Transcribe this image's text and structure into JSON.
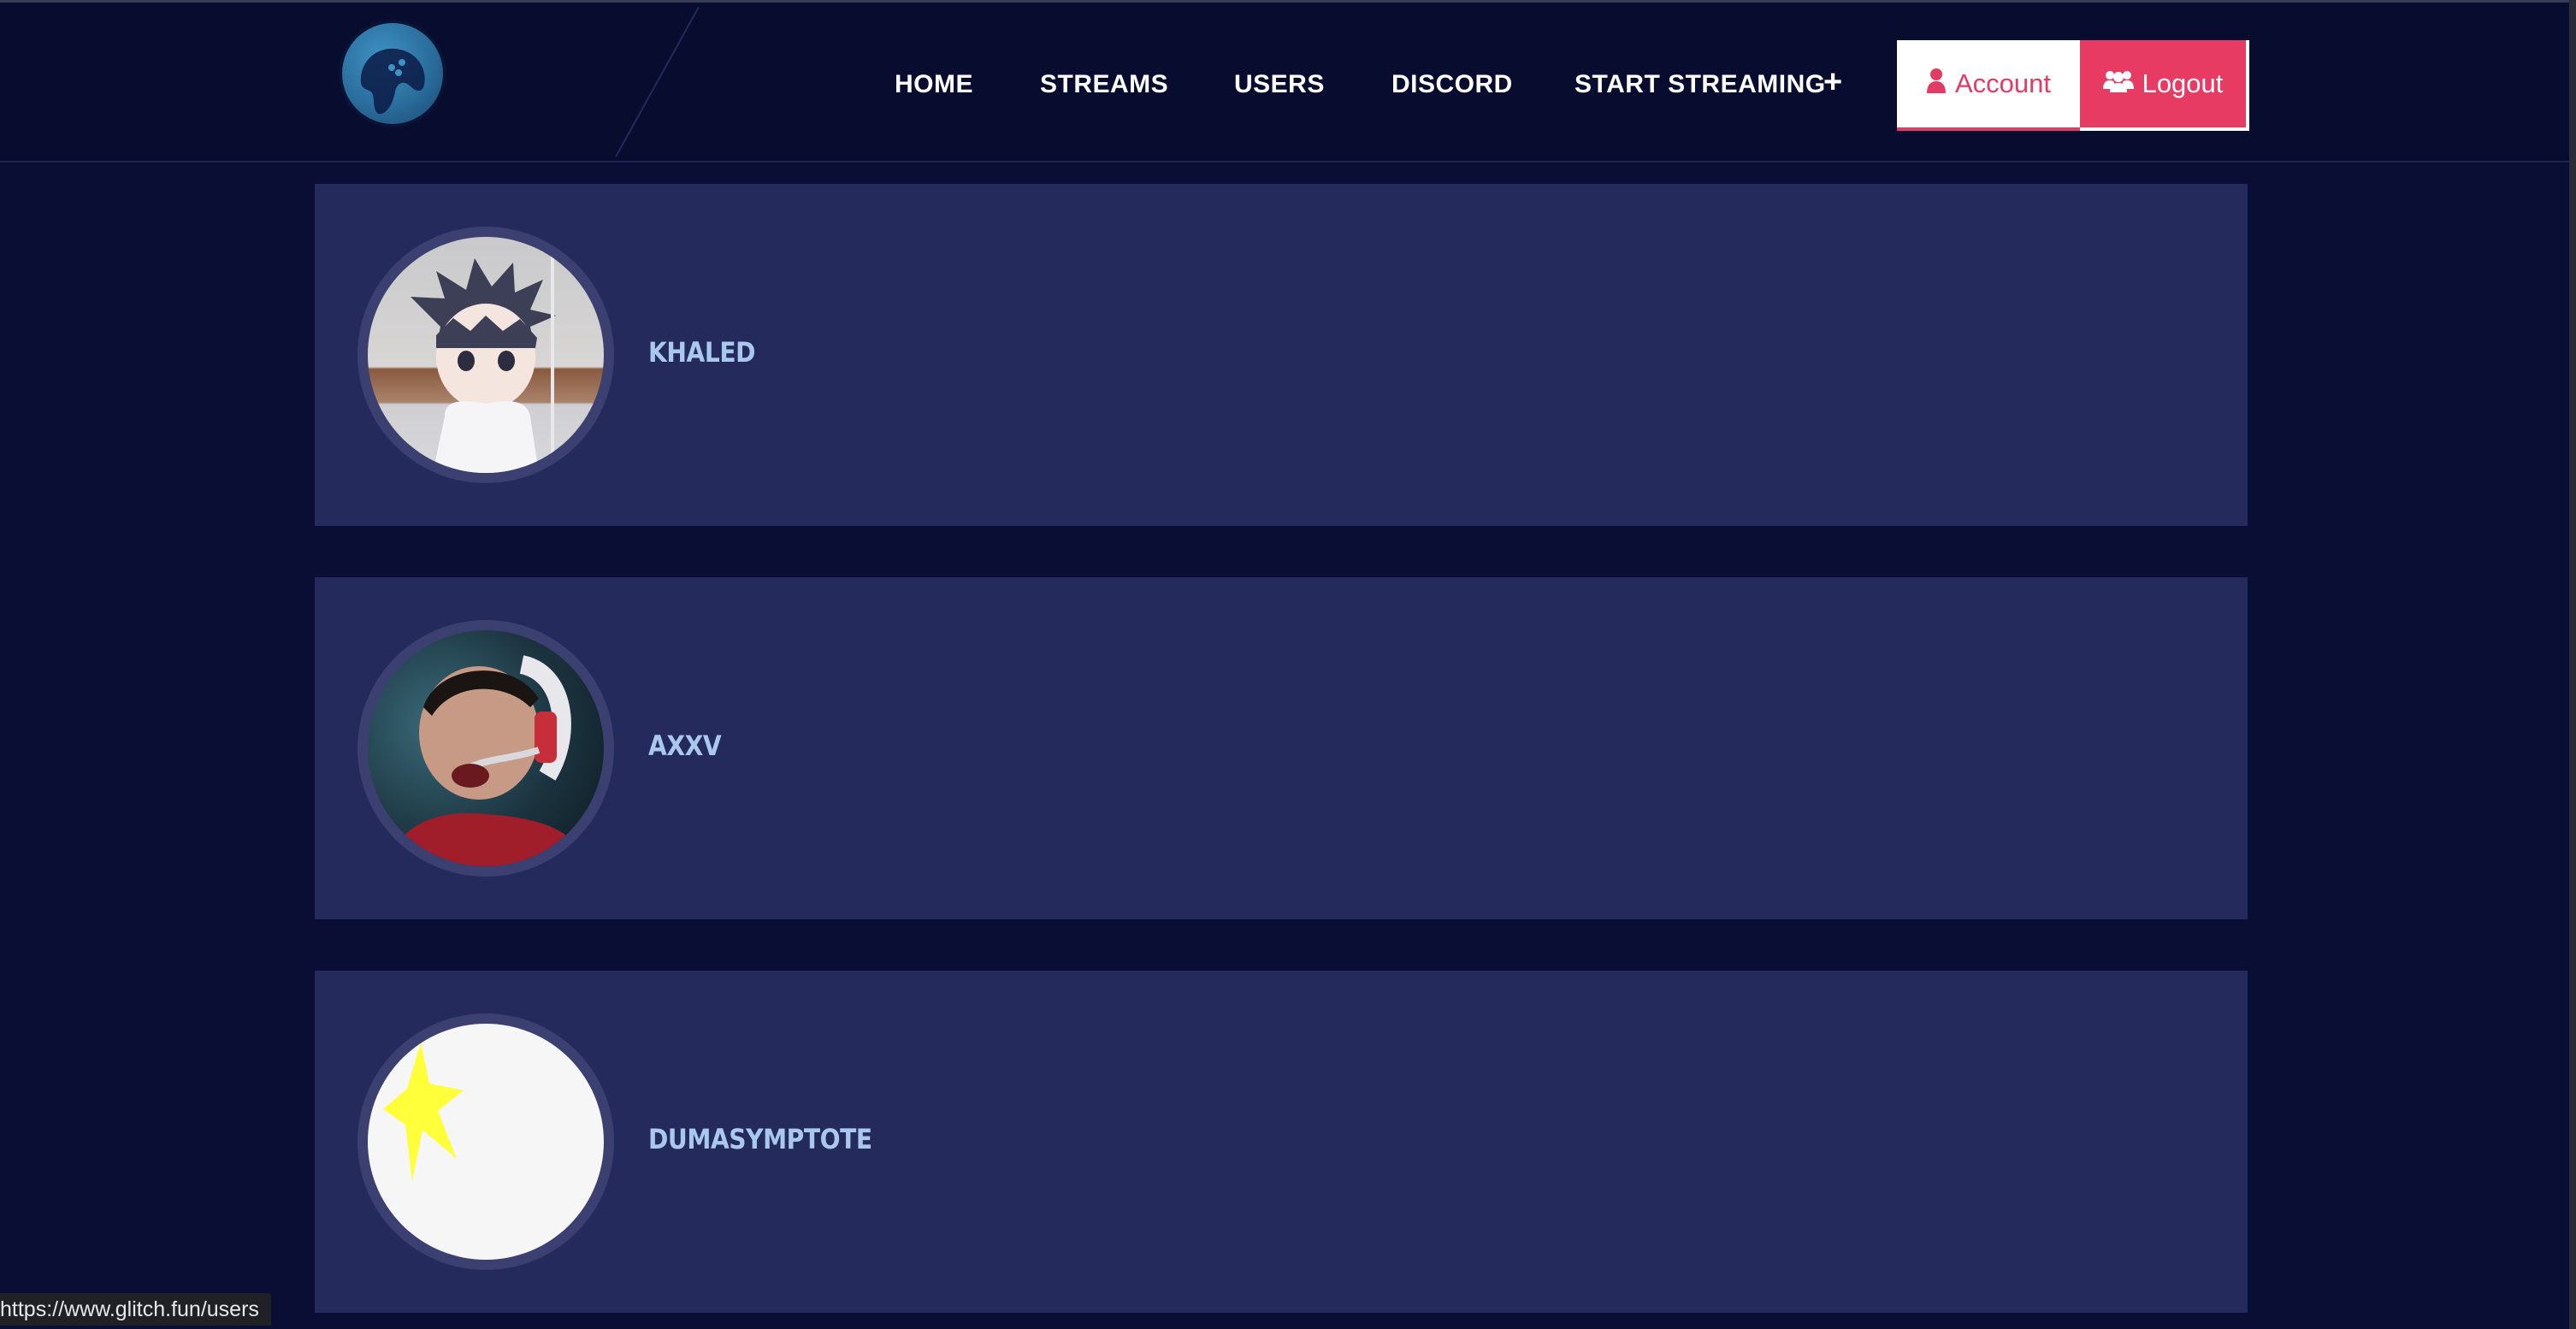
{
  "nav": {
    "home": "HOME",
    "streams": "STREAMS",
    "users": "USERS",
    "discord": "DISCORD",
    "start_streaming": "START STREAMING",
    "plus": "+"
  },
  "buttons": {
    "account": "Account",
    "logout": "Logout"
  },
  "users": [
    {
      "name": "KHALED"
    },
    {
      "name": "AXXV"
    },
    {
      "name": "DUMASYMPTOTE"
    }
  ],
  "status_bar": {
    "url": "https://www.glitch.fun/users"
  },
  "colors": {
    "background": "#0a0e34",
    "card": "#242a5c",
    "accent": "#e83b63",
    "username": "#a9c8ee"
  }
}
